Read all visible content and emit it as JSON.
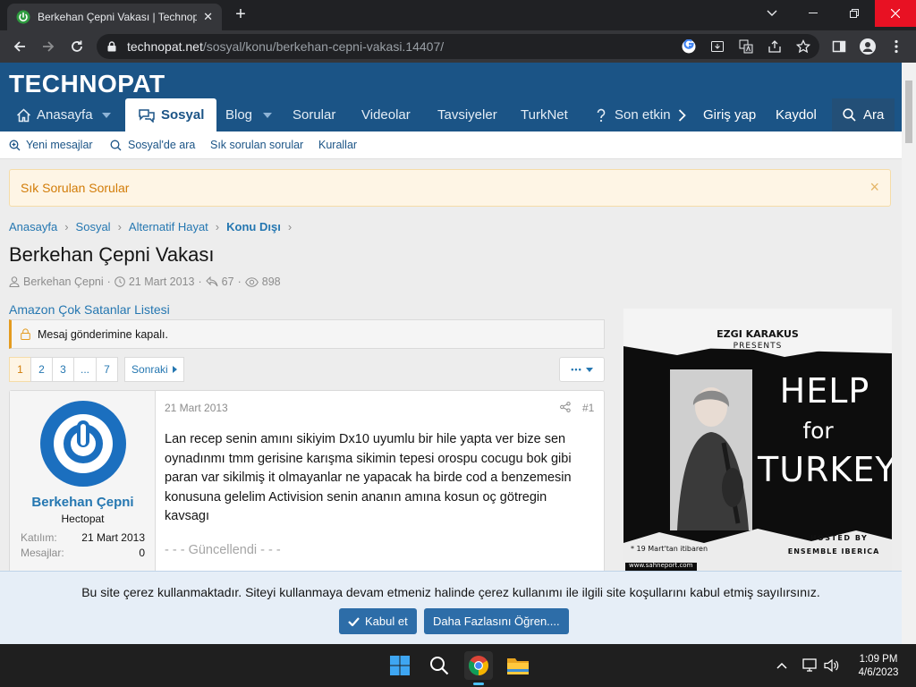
{
  "browser": {
    "tab_title": "Berkehan Çepni Vakası | Technopat",
    "tab_close": "✕",
    "new_tab": "+",
    "url_host": "technopat.net",
    "url_path": "/sosyal/konu/berkehan-cepni-vakasi.14407/"
  },
  "site": {
    "logo": "TECHNOPAT",
    "nav": [
      "Anasayfa",
      "Sosyal",
      "Blog",
      "Sorular",
      "Videolar",
      "Tavsiyeler",
      "TurkNet",
      "Son etkin"
    ],
    "nav_right": {
      "login": "Giriş yap",
      "register": "Kaydol",
      "search": "Ara"
    },
    "subnav": [
      "Yeni mesajlar",
      "Sosyal'de ara",
      "Sık sorulan sorular",
      "Kurallar"
    ]
  },
  "notice": {
    "text": "Sık Sorulan Sorular",
    "close": "×"
  },
  "breadcrumb": [
    "Anasayfa",
    "Sosyal",
    "Alternatif Hayat",
    "Konu Dışı"
  ],
  "thread": {
    "title": "Berkehan Çepni Vakası",
    "author": "Berkehan Çepni",
    "date": "21 Mart 2013",
    "replies": "67",
    "views": "898",
    "separator": "·"
  },
  "amazon_link": "Amazon Çok Satanlar Listesi",
  "closed_notice": "Mesaj gönderimine kapalı.",
  "pagination": {
    "pages": [
      "1",
      "2",
      "3",
      "...",
      "7"
    ],
    "current": "1",
    "next": "Sonraki"
  },
  "more_button": "•••",
  "post": {
    "username": "Berkehan Çepni",
    "user_title": "Hectopat",
    "stats": [
      {
        "key": "Katılım:",
        "value": "21 Mart 2013"
      },
      {
        "key": "Mesajlar:",
        "value": "0"
      }
    ],
    "date": "21 Mart 2013",
    "number": "#1",
    "text": "Lan recep senin amını sikiyim Dx10 uyumlu bir hile yapta ver bize sen oynadınmı tmm gerisine karışma sikimin tepesi orospu cocugu bok gibi paran var sikilmiş it olmayanlar ne yapacak ha birde cod a benzemesin konusuna gelelim Activision senin ananın amına kosun oç götregin kavsagı",
    "updated": "- - - Güncellendi - - -"
  },
  "ad": {
    "presenter": "EZGI KARAKUS",
    "presents": "PRESENTS",
    "line1": "HELP",
    "line2": "for",
    "line3": "TURKEY",
    "date_note": "* 19 Mart'tan itibaren",
    "hosted_by": "HOSTED BY",
    "host": "ENSEMBLE IBERICA",
    "url": "www.sahneport.com"
  },
  "cookie": {
    "text": "Bu site çerez kullanmaktadır. Siteyi kullanmaya devam etmeniz halinde çerez kullanımı ile ilgili site koşullarını kabul etmiş sayılırsınız.",
    "accept": "Kabul et",
    "learn_more": "Daha Fazlasını Öğren...."
  },
  "taskbar": {
    "time": "1:09 PM",
    "date": "4/6/2023"
  },
  "colors": {
    "brand": "#1b5486",
    "link": "#2577b1",
    "notice_bg": "#fef5e5",
    "notice_text": "#d27c08",
    "close_red": "#e81123"
  }
}
